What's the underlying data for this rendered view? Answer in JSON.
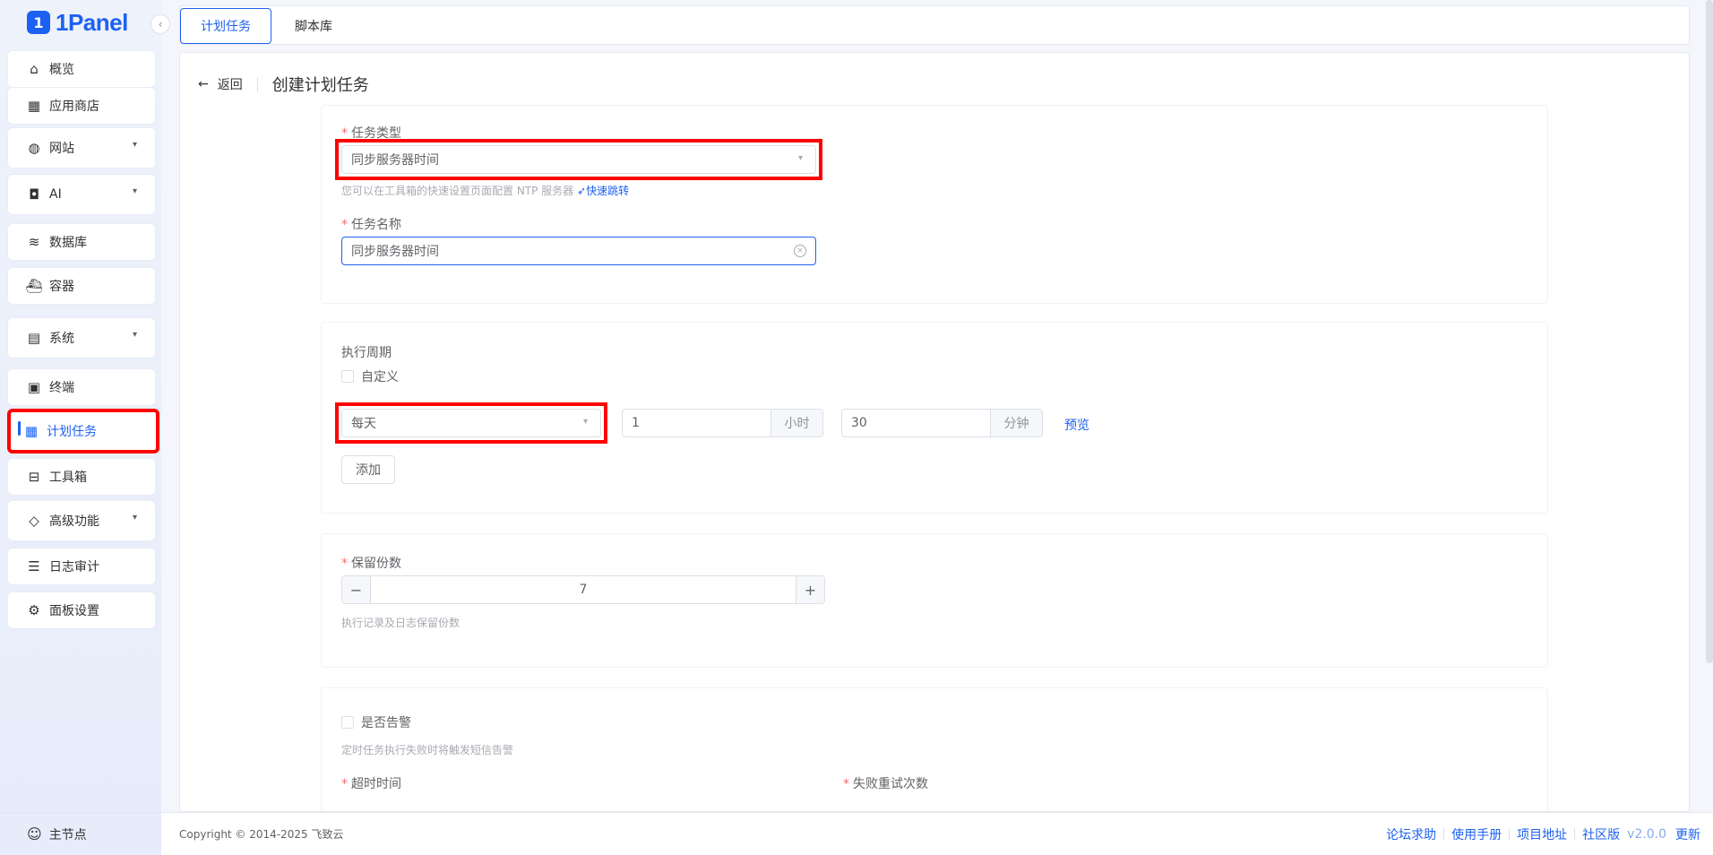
{
  "app": {
    "logo_mark": "1",
    "logo_text": "1Panel"
  },
  "sidebar": {
    "items": [
      {
        "label": "概览",
        "icon": "home-icon",
        "has_chevron": false
      },
      {
        "label": "应用商店",
        "icon": "grid-icon",
        "has_chevron": false
      },
      {
        "label": "网站",
        "icon": "globe-icon",
        "has_chevron": true
      },
      {
        "label": "AI",
        "icon": "robot-icon",
        "has_chevron": true
      },
      {
        "label": "数据库",
        "icon": "layers-icon",
        "has_chevron": false
      },
      {
        "label": "容器",
        "icon": "docker-icon",
        "has_chevron": false
      },
      {
        "label": "系统",
        "icon": "server-icon",
        "has_chevron": true
      },
      {
        "label": "终端",
        "icon": "terminal-icon",
        "has_chevron": false
      },
      {
        "label": "计划任务",
        "icon": "calendar-icon",
        "has_chevron": false,
        "active": true
      },
      {
        "label": "工具箱",
        "icon": "toolbox-icon",
        "has_chevron": false
      },
      {
        "label": "高级功能",
        "icon": "diamond-icon",
        "has_chevron": true
      },
      {
        "label": "日志审计",
        "icon": "log-icon",
        "has_chevron": false
      },
      {
        "label": "面板设置",
        "icon": "gear-icon",
        "has_chevron": false
      }
    ],
    "footer_label": "主节点"
  },
  "tabs": [
    {
      "label": "计划任务",
      "active": true
    },
    {
      "label": "脚本库",
      "active": false
    }
  ],
  "page": {
    "back_label": "返回",
    "title": "创建计划任务"
  },
  "form": {
    "task_type": {
      "label": "任务类型",
      "value": "同步服务器时间",
      "hint": "您可以在工具箱的快速设置页面配置 NTP 服务器",
      "hint_link": "快速跳转"
    },
    "task_name": {
      "label": "任务名称",
      "value": "同步服务器时间"
    },
    "cycle": {
      "label": "执行周期",
      "custom_label": "自定义",
      "period_value": "每天",
      "hour_value": "1",
      "hour_unit": "小时",
      "minute_value": "30",
      "minute_unit": "分钟",
      "preview_label": "预览",
      "add_label": "添加"
    },
    "retain": {
      "label": "保留份数",
      "value": "7",
      "hint": "执行记录及日志保留份数"
    },
    "alert": {
      "label": "是否告警",
      "hint": "定时任务执行失败时将触发短信告警"
    },
    "timeout_label": "超时时间",
    "retry_label": "失败重试次数"
  },
  "footer": {
    "copyright": "Copyright © 2014-2025 飞致云",
    "links": [
      "论坛求助",
      "使用手册",
      "项目地址",
      "社区版"
    ],
    "version": "v2.0.0",
    "update_label": "更新"
  },
  "colors": {
    "accent": "#1d61f2",
    "highlight": "#ff0000",
    "required": "#f56c6c"
  }
}
